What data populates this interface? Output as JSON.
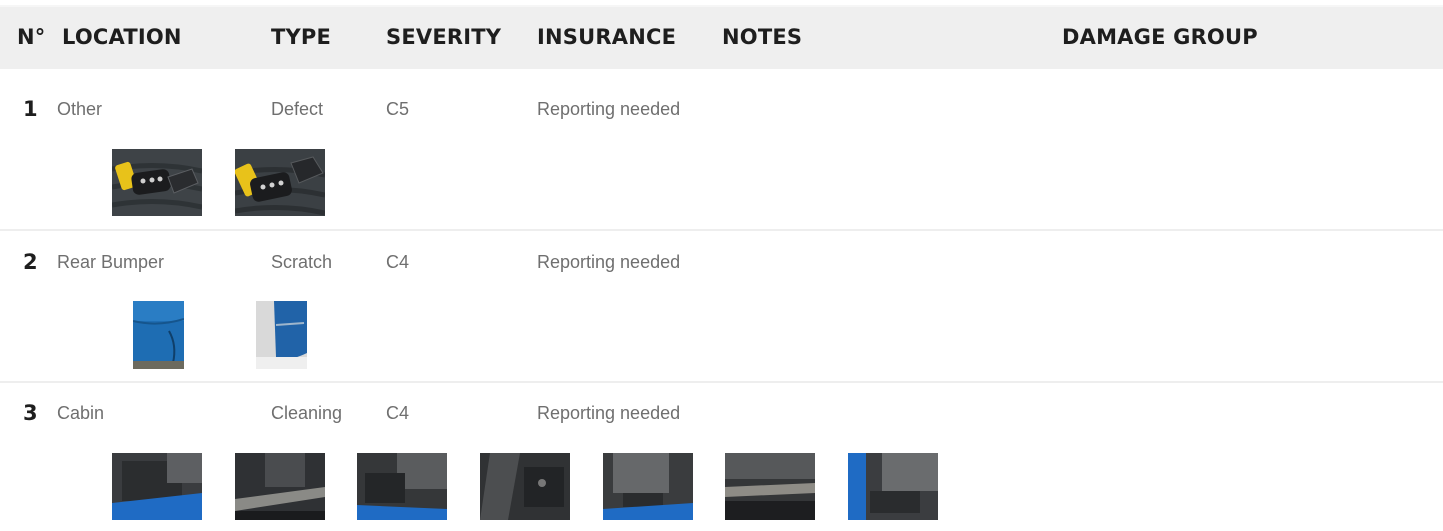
{
  "headers": {
    "no": "N°",
    "location": "LOCATION",
    "type": "TYPE",
    "severity": "SEVERITY",
    "insurance": "INSURANCE",
    "notes": "NOTES",
    "damage_group": "DAMAGE GROUP"
  },
  "rows": [
    {
      "no": "1",
      "location": "Other",
      "type": "Defect",
      "severity": "C5",
      "insurance": "Reporting needed",
      "notes": "",
      "damage_group": "",
      "photos": [
        "key-fob-photo",
        "key-fob-photo"
      ]
    },
    {
      "no": "2",
      "location": "Rear Bumper",
      "type": "Scratch",
      "severity": "C4",
      "insurance": "Reporting needed",
      "notes": "",
      "damage_group": "",
      "photos": [
        "blue-bumper-photo",
        "blue-bumper-badge-photo"
      ]
    },
    {
      "no": "3",
      "location": "Cabin",
      "type": "Cleaning",
      "severity": "C4",
      "insurance": "Reporting needed",
      "notes": "",
      "damage_group": "",
      "photos": [
        "cabin-floor-photo",
        "cabin-floor-photo",
        "cabin-floor-photo",
        "cabin-floor-photo",
        "cabin-floor-photo",
        "cabin-floor-photo",
        "cabin-floor-photo"
      ]
    }
  ],
  "colors": {
    "header_bg": "#efefef",
    "header_text": "#1e1e1e",
    "cell_text": "#6f6f6f",
    "separator": "#eeeeee",
    "car_blue": "#1f6bc4",
    "key_yellow": "#e8c21a"
  }
}
